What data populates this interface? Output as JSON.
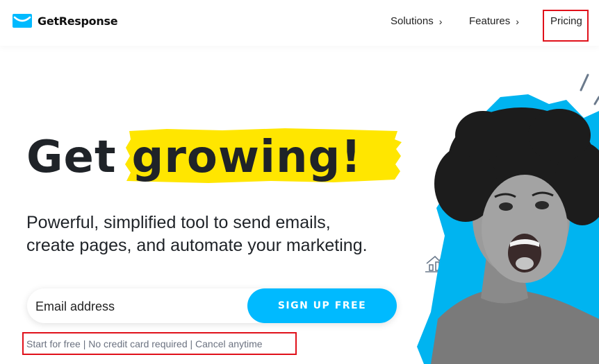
{
  "header": {
    "logo_text": "GetResponse",
    "nav": {
      "solutions": "Solutions",
      "features": "Features",
      "pricing": "Pricing"
    },
    "chevron": "›"
  },
  "hero": {
    "headline_get": "Get",
    "headline_growing": "growing!",
    "subtitle_line1": "Powerful, simplified tool to send emails,",
    "subtitle_line2": "create pages, and automate your marketing.",
    "email_placeholder": "Email address",
    "signup_label": "SIGN UP FREE",
    "note": "Start for free | No credit card required | Cancel anytime"
  },
  "colors": {
    "brand_blue": "#00baff",
    "highlight_yellow": "#ffe600",
    "annotation_red": "#e0101a"
  },
  "icons": [
    "envelope-logo-icon",
    "chevron-right-icon",
    "trend-chart-icon"
  ]
}
